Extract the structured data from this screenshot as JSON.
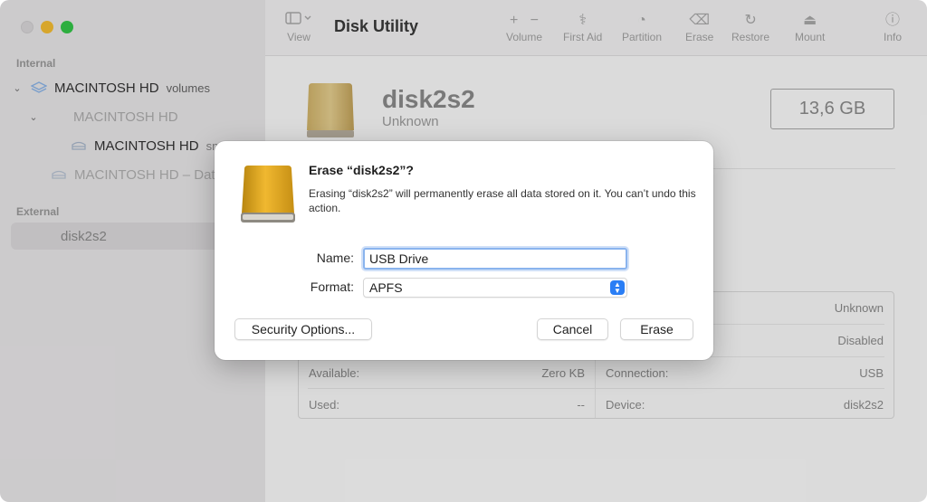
{
  "app": {
    "title": "Disk Utility"
  },
  "sidebar": {
    "internal_header": "Internal",
    "external_header": "External",
    "items": [
      {
        "label": "MACINTOSH HD",
        "suffix": "volumes"
      },
      {
        "label": "MACINTOSH HD"
      },
      {
        "label": "MACINTOSH HD",
        "suffix": "sn"
      },
      {
        "label": "MACINTOSH HD – Dat"
      },
      {
        "label": "disk2s2"
      }
    ]
  },
  "toolbar": {
    "view_label": "View",
    "volume_label": "Volume",
    "first_aid_label": "First Aid",
    "partition_label": "Partition",
    "erase_label": "Erase",
    "restore_label": "Restore",
    "mount_label": "Mount",
    "info_label": "Info"
  },
  "disk": {
    "name": "disk2s2",
    "type": "Unknown",
    "size": "13,6 GB"
  },
  "info": {
    "rows": [
      {
        "left_label": "",
        "left_value": "",
        "right_label": "",
        "right_value": "Unknown"
      },
      {
        "left_label": "",
        "left_value": "",
        "right_label": "",
        "right_value": "Disabled"
      },
      {
        "left_label": "Available:",
        "left_value": "Zero KB",
        "right_label": "Connection:",
        "right_value": "USB"
      },
      {
        "left_label": "Used:",
        "left_value": "--",
        "right_label": "Device:",
        "right_value": "disk2s2"
      }
    ]
  },
  "dialog": {
    "title": "Erase “disk2s2”?",
    "message": "Erasing “disk2s2” will permanently erase all data stored on it. You can’t undo this action.",
    "name_label": "Name:",
    "name_value": "USB Drive",
    "format_label": "Format:",
    "format_value": "APFS",
    "security_button": "Security Options...",
    "cancel_button": "Cancel",
    "erase_button": "Erase"
  },
  "colors": {
    "accent": "#2a7ef5",
    "close": "#dad8da",
    "minimize": "#f5bd33",
    "maximize": "#34c748",
    "drive_gold": "#d9a13a"
  }
}
